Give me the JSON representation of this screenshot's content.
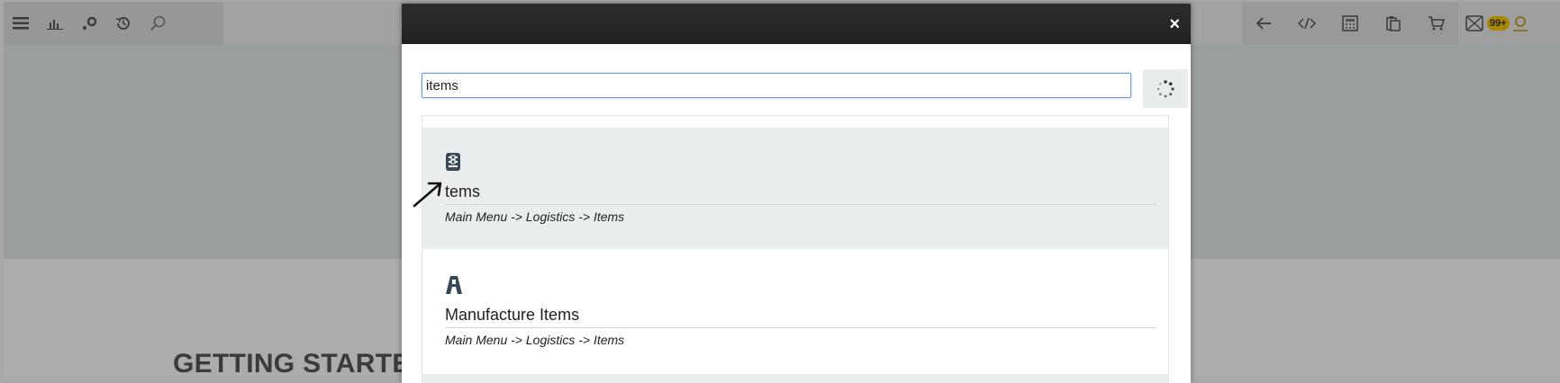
{
  "background": {
    "heading": "GETTING STARTE"
  },
  "topbar": {
    "left_icons": [
      "menu-icon",
      "bar-chart-icon",
      "share-nodes-icon",
      "history-icon",
      "search-icon"
    ],
    "right_icons": [
      "back-arrow-icon",
      "code-icon",
      "calculator-icon",
      "clipboard-icon",
      "cart-icon"
    ],
    "notification_badge": "99+"
  },
  "modal": {
    "close_label": "×",
    "search": {
      "value": "items",
      "placeholder": ""
    },
    "results": [
      {
        "title": "tems",
        "path": "Main Menu -> Logistics -> Items",
        "icon": "warehouse-icon",
        "highlighted": true
      },
      {
        "title": "Manufacture Items",
        "path": "Main Menu -> Logistics -> Items",
        "icon": "manufacture-icon",
        "highlighted": false
      }
    ]
  },
  "colors": {
    "header_bg": "#222425",
    "input_border": "#6a9bd1",
    "badge": "#f2c200",
    "highlight_row": "#eaeeee",
    "icon": "#3b4a5a"
  }
}
